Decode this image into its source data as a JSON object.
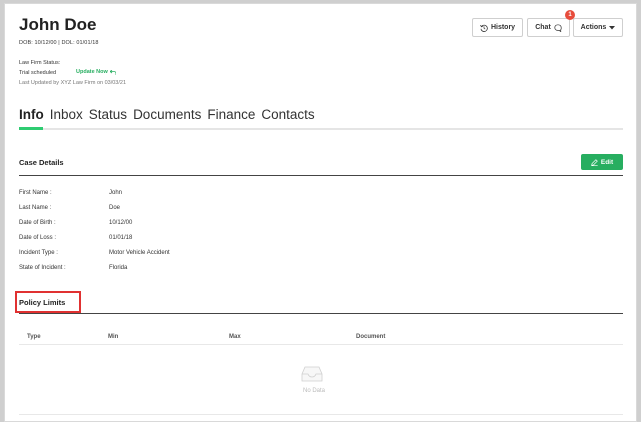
{
  "header": {
    "title": "John Doe",
    "dob_dol": "DOB: 10/12/00 | DOL: 01/01/18",
    "firm_status_label": "Law Firm Status:",
    "trial_status": "Trial scheduled",
    "update_now": "Update Now",
    "last_updated": "Last Updated by XYZ Law Firm on 03/03/21"
  },
  "toolbar": {
    "history_label": "History",
    "chat_label": "Chat",
    "chat_badge": "1",
    "actions_label": "Actions"
  },
  "tabs": [
    {
      "label": "Info"
    },
    {
      "label": "Inbox"
    },
    {
      "label": "Status"
    },
    {
      "label": "Documents"
    },
    {
      "label": "Finance"
    },
    {
      "label": "Contacts"
    }
  ],
  "case_details": {
    "title": "Case Details",
    "edit_label": "Edit",
    "fields": [
      {
        "label": "First Name :",
        "value": "John"
      },
      {
        "label": "Last Name :",
        "value": "Doe"
      },
      {
        "label": "Date of Birth :",
        "value": "10/12/00"
      },
      {
        "label": "Date of Loss :",
        "value": "01/01/18"
      },
      {
        "label": "Incident Type :",
        "value": "Motor Vehicle Accident"
      },
      {
        "label": "State of Incident :",
        "value": "Florida"
      }
    ]
  },
  "policy_limits": {
    "title": "Policy Limits",
    "columns": [
      "Type",
      "Min",
      "Max",
      "Document"
    ],
    "empty_text": "No Data"
  },
  "colors": {
    "accent_green": "#27ae60",
    "badge_red": "#e74c3c",
    "highlight_red": "#e03131"
  }
}
